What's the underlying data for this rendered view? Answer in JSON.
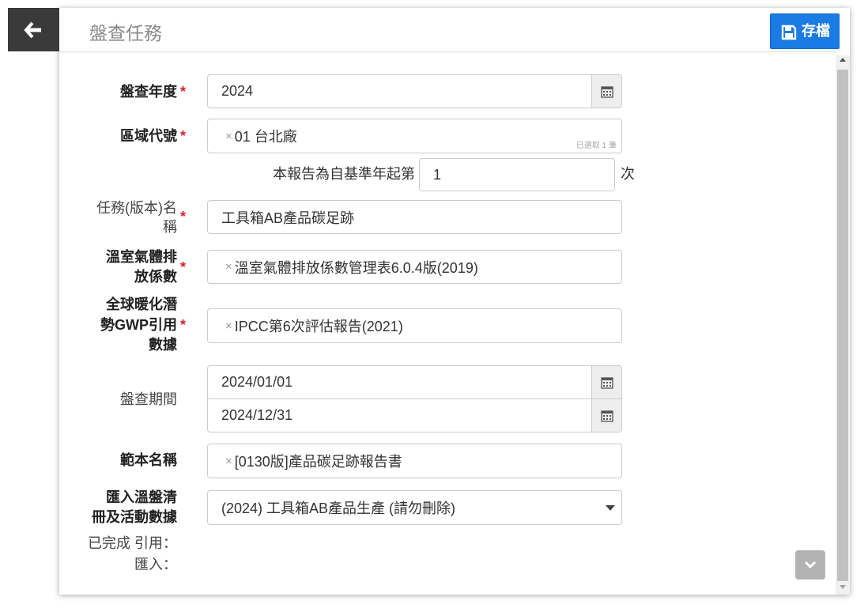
{
  "header": {
    "back_button": {
      "icon": "arrow-left-icon"
    },
    "title": "盤查任務",
    "save_button": {
      "label": "存檔",
      "icon": "floppy-disk-icon"
    }
  },
  "form": {
    "inventory_year": {
      "label": "盤查年度",
      "required_mark": "*",
      "value": "2024",
      "picker_icon": "calendar-icon"
    },
    "region_code": {
      "label": "區域代號",
      "required_mark": "*",
      "selected_tags": [
        "01 台北廠"
      ],
      "selected_count": "已選取 1 筆"
    },
    "report_sequence": {
      "prefix": "本報告為自基準年起第",
      "value": "1",
      "suffix": "次"
    },
    "task_name": {
      "label_lines": [
        "任務(版本)名",
        "稱"
      ],
      "required_mark": "*",
      "value": "工具箱AB產品碳足跡"
    },
    "emission_factor": {
      "label_lines": [
        "溫室氣體排",
        "放係數"
      ],
      "required_mark": "*",
      "selected_tags": [
        "溫室氣體排放係數管理表6.0.4版(2019)"
      ]
    },
    "gwp_reference": {
      "label_lines": [
        "全球暖化潛",
        "勢GWP引用",
        "數據"
      ],
      "required_mark": "*",
      "selected_tags": [
        "IPCC第6次評估報告(2021)"
      ]
    },
    "inventory_period": {
      "label": "盤查期間",
      "start_date": "2024/01/01",
      "end_date": "2024/12/31",
      "picker_icon": "calendar-icon"
    },
    "template_name": {
      "label": "範本名稱",
      "selected_tags": [
        "[0130版]產品碳足跡報告書"
      ]
    },
    "import_inventory": {
      "label_lines": [
        "匯入溫盤清",
        "冊及活動數據"
      ],
      "selected_option": "(2024) 工具箱AB產品生產 (請勿刪除)"
    },
    "completion_status": {
      "cite_label": "已完成 引用：",
      "import_label": "匯入："
    }
  },
  "scroll_down_button": {
    "icon": "chevron-down-icon"
  },
  "icons": {
    "tag_remove": "remove-tag-icon"
  },
  "colors": {
    "save_button": "#1a7be4",
    "required_mark": "#d9232e",
    "back_button": "#3a3a3a",
    "title": "#8a8a8a",
    "addon_bg": "#eeeeee"
  }
}
